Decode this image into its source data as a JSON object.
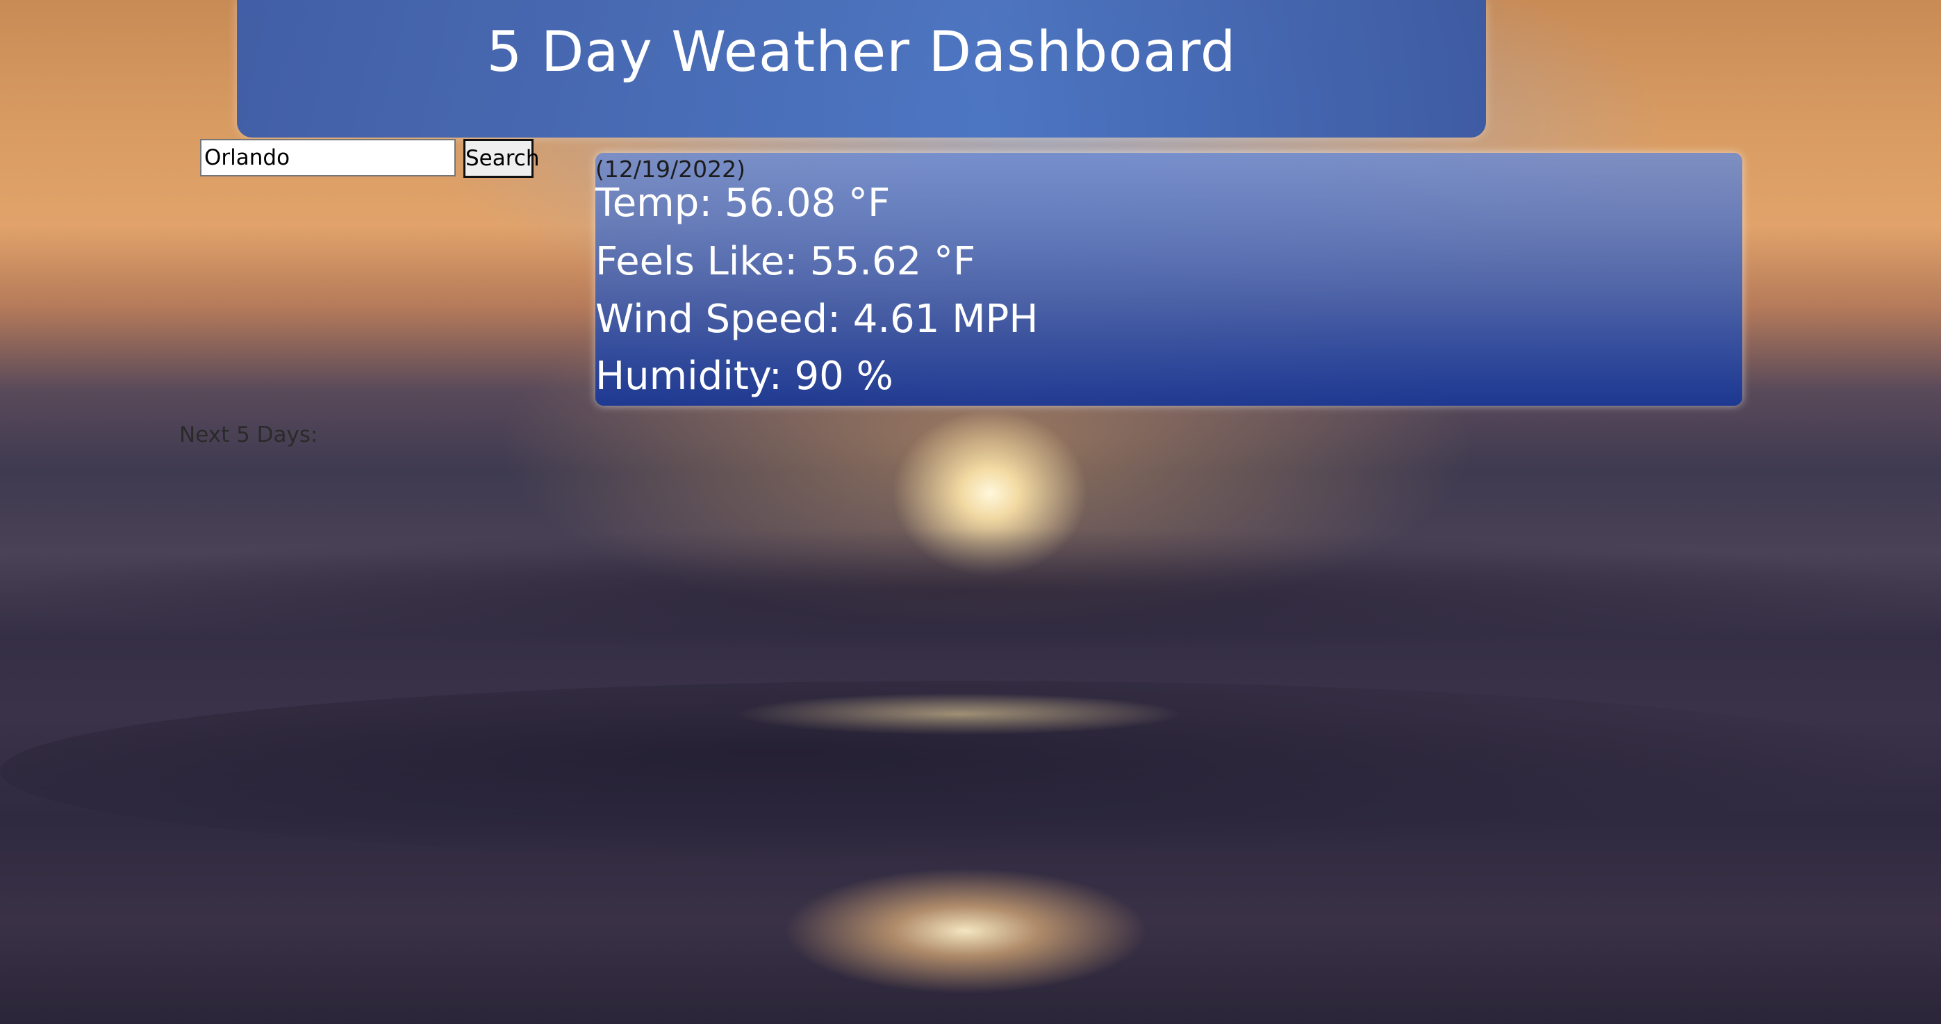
{
  "header": {
    "title": "5 Day Weather Dashboard"
  },
  "search": {
    "value": "Orlando",
    "button_label": "Search"
  },
  "current": {
    "date": "(12/19/2022)",
    "temp": "Temp: 56.08 °F",
    "feels_like": "Feels Like: 55.62 °F",
    "wind": "Wind Speed: 4.61 MPH",
    "humidity": "Humidity: 90 %"
  },
  "forecast": {
    "label": "Next 5 Days:"
  }
}
